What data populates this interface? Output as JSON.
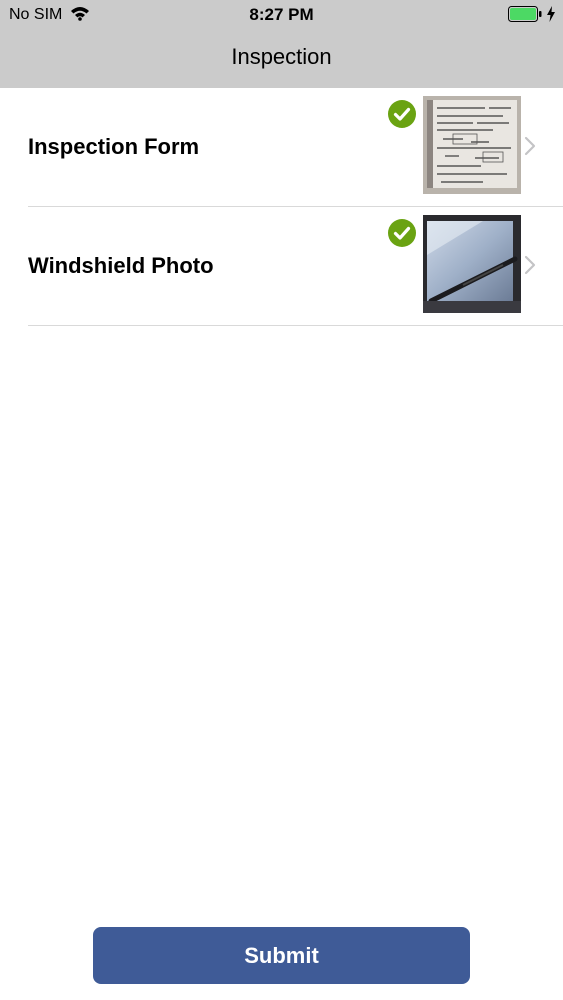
{
  "status_bar": {
    "carrier": "No SIM",
    "time": "8:27 PM",
    "battery_color": "#4cd964"
  },
  "nav": {
    "title": "Inspection"
  },
  "items": [
    {
      "label": "Inspection Form",
      "completed": true,
      "thumbnail": "scanned-form-photo",
      "accessory": "chevron-right-icon"
    },
    {
      "label": "Windshield Photo",
      "completed": true,
      "thumbnail": "windshield-wiper-photo",
      "accessory": "chevron-right-icon"
    }
  ],
  "submit": {
    "label": "Submit",
    "color": "#3f5b97"
  },
  "colors": {
    "nav_background": "#cbcbcb",
    "check_green": "#6aa312",
    "separator": "#d9d9d9"
  }
}
